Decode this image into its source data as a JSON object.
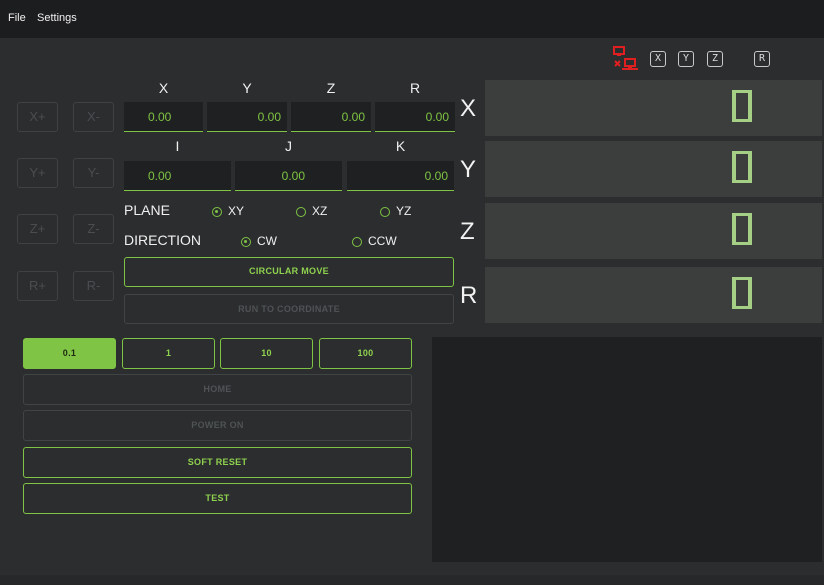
{
  "menu": {
    "file": "File",
    "settings": "Settings"
  },
  "status": {
    "connection_icon": "network-disconnected-icon",
    "axes": [
      "X",
      "Y",
      "Z",
      "R"
    ]
  },
  "jog": {
    "x_plus": "X+",
    "x_minus": "X-",
    "y_plus": "Y+",
    "y_minus": "Y-",
    "z_plus": "Z+",
    "z_minus": "Z-",
    "r_plus": "R+",
    "r_minus": "R-"
  },
  "coords": {
    "labels": [
      "X",
      "Y",
      "Z",
      "R"
    ],
    "values": [
      "0.00",
      "0.00",
      "0.00",
      "0.00"
    ]
  },
  "ijk": {
    "labels": [
      "I",
      "J",
      "K"
    ],
    "values": [
      "0.00",
      "0.00",
      "0.00"
    ]
  },
  "plane": {
    "label": "PLANE",
    "options": [
      "XY",
      "XZ",
      "YZ"
    ],
    "selected": "XY"
  },
  "direction": {
    "label": "DIRECTION",
    "options": [
      "CW",
      "CCW"
    ],
    "selected": "CW"
  },
  "buttons": {
    "circular_move": "CIRCULAR MOVE",
    "run_to_coordinate": "RUN TO COORDINATE",
    "home": "HOME",
    "power_on": "POWER ON",
    "soft_reset": "SOFT RESET",
    "test": "TEST"
  },
  "steps": {
    "options": [
      "0.1",
      "1",
      "10",
      "100"
    ],
    "selected": "0.1"
  },
  "dro": {
    "axes": [
      "X",
      "Y",
      "Z",
      "R"
    ]
  },
  "colors": {
    "accent": "#7fc444",
    "background": "#2b2d2e",
    "error": "#e02020"
  }
}
